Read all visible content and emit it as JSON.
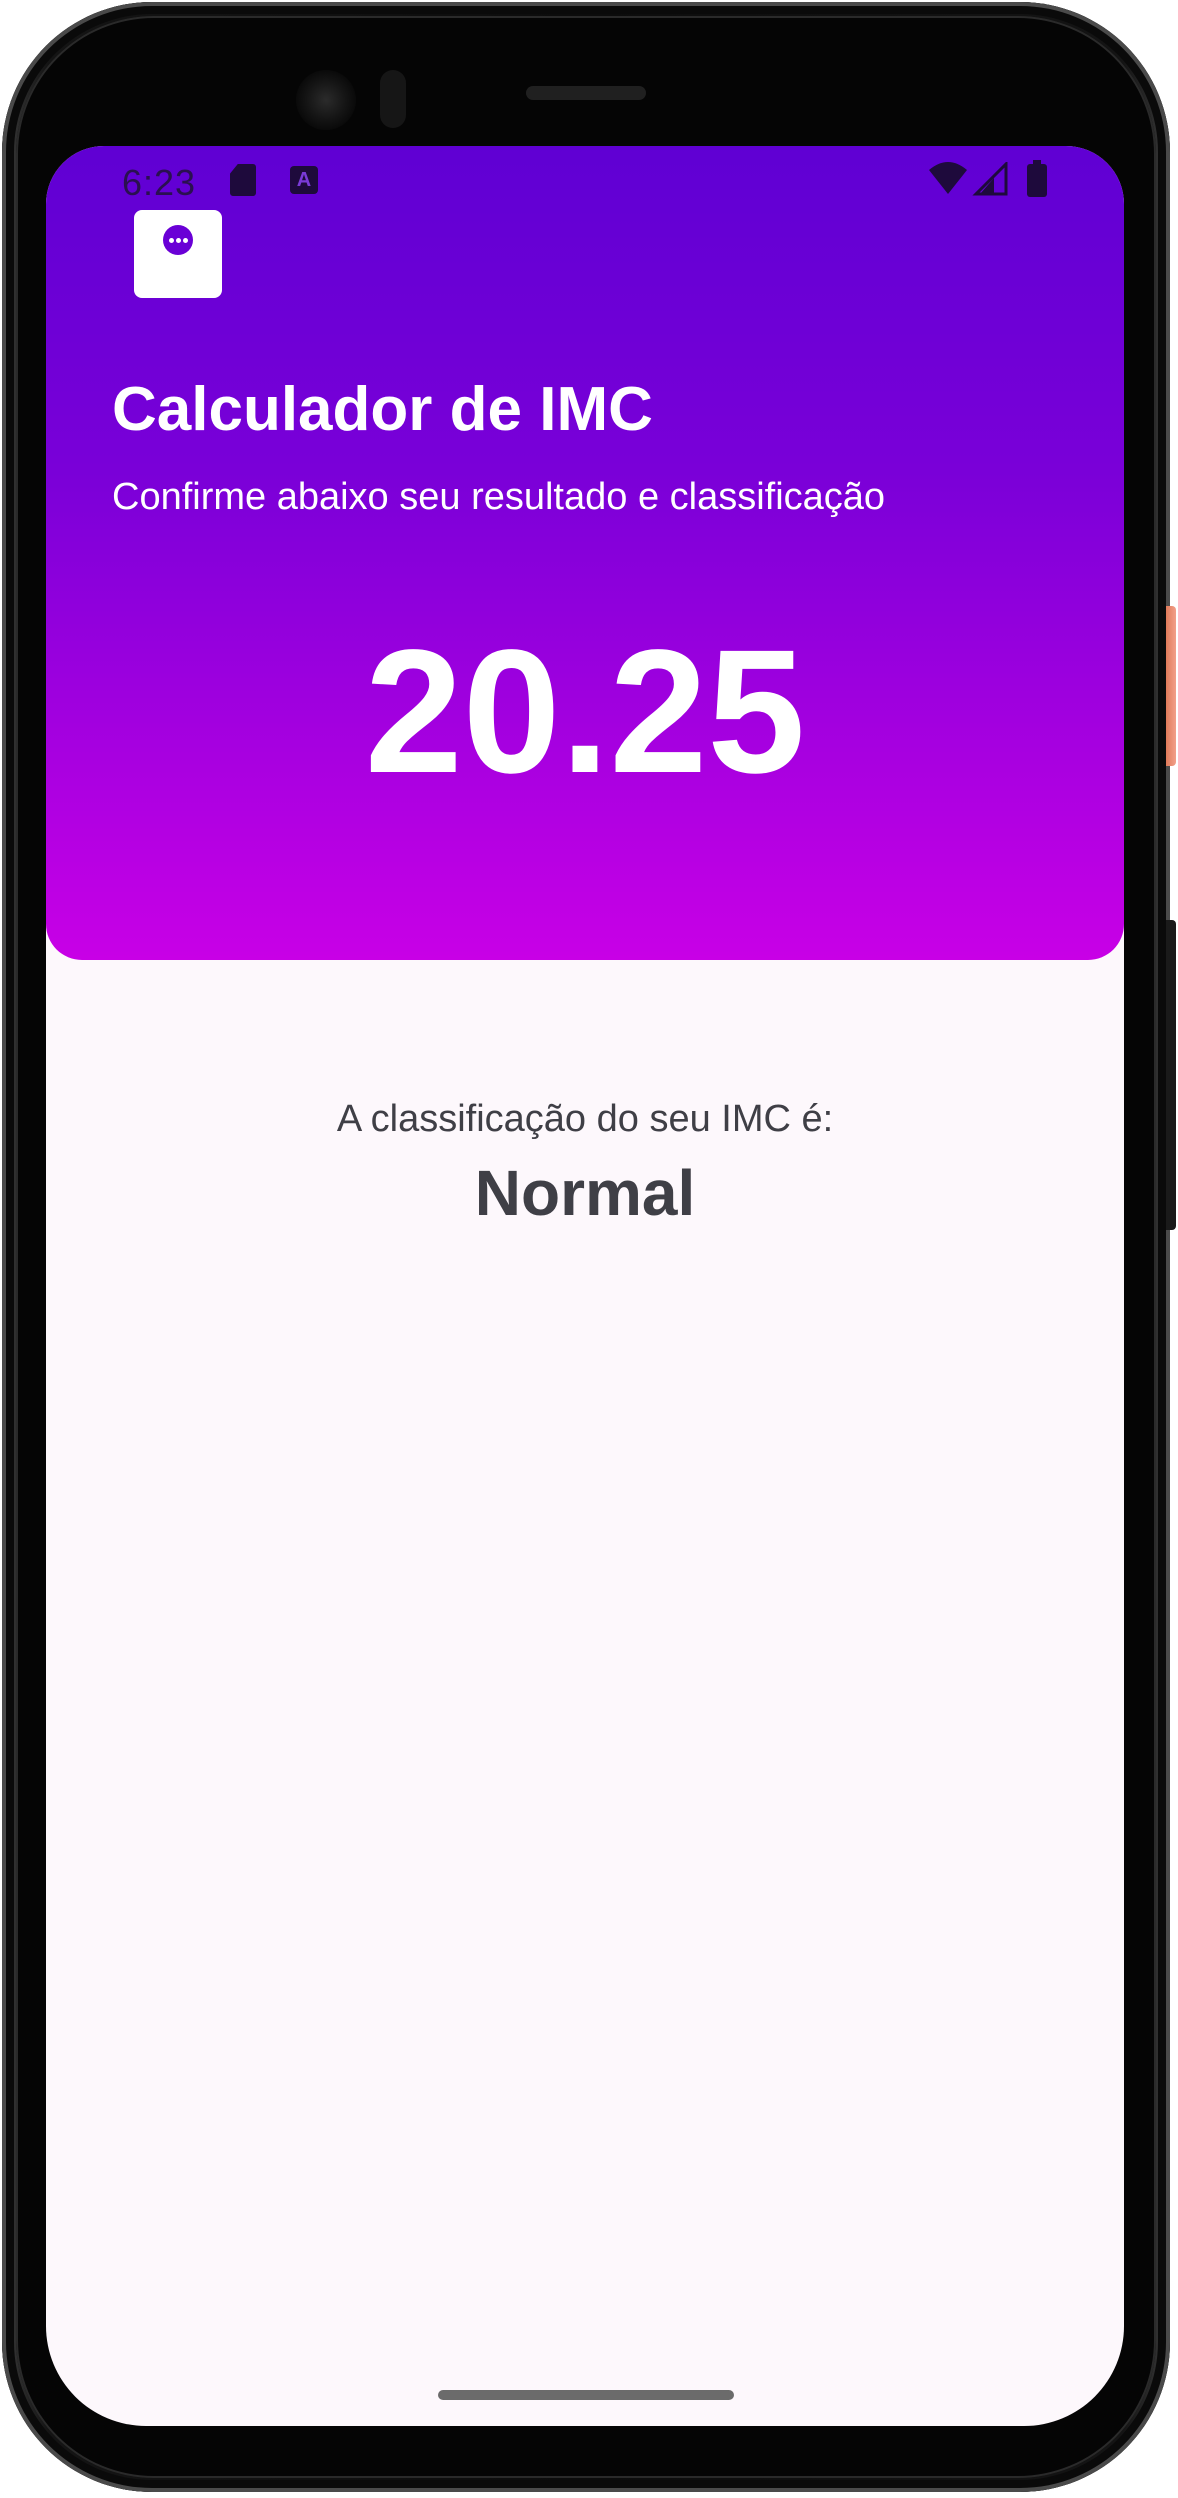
{
  "status_bar": {
    "time": "6:23",
    "sd_icon": "sd-card-icon",
    "a_icon": "a-badge-icon",
    "a_icon_letter": "A",
    "wifi_icon": "wifi-icon",
    "signal_icon": "cellular-signal-icon",
    "battery_icon": "battery-icon"
  },
  "header": {
    "menu_icon": "more-horizontal-circle-icon",
    "title": "Calculador de IMC",
    "subtitle": "Confirme abaixo seu resultado e classificação",
    "bmi_value": "20.25"
  },
  "result": {
    "label": "A classificação do seu IMC é:",
    "classification": "Normal"
  },
  "colors": {
    "header_gradient_top": "#5f00d3",
    "header_gradient_bottom": "#c800e6",
    "background": "#fdf8fc",
    "text_dark": "#3f3f46",
    "accent": "#6a00d6"
  }
}
